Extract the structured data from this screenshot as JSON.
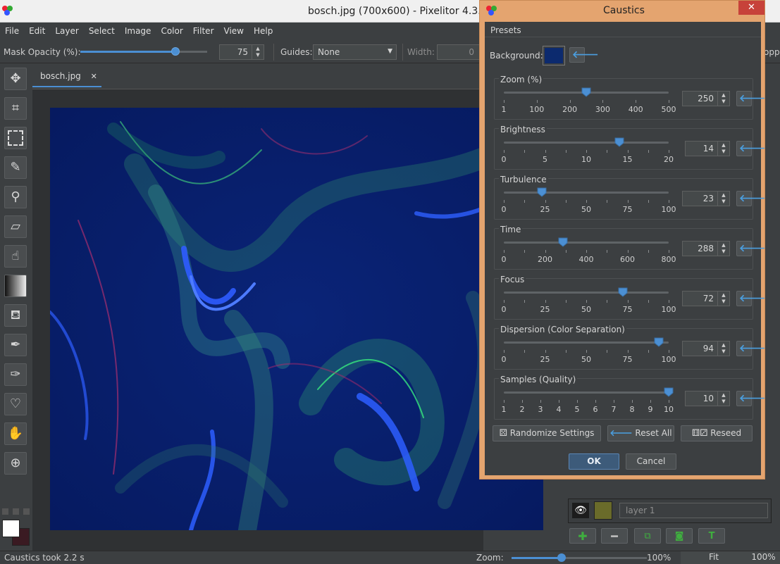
{
  "window": {
    "title": "bosch.jpg (700x600) - Pixelitor 4.3.0"
  },
  "menu": [
    "File",
    "Edit",
    "Layer",
    "Select",
    "Image",
    "Color",
    "Filter",
    "View",
    "Help"
  ],
  "toolbar": {
    "mask_opacity_label": "Mask Opacity (%):",
    "mask_opacity_value": "75",
    "mask_opacity_fraction": 0.75,
    "guides_label": "Guides:",
    "guides_value": "None",
    "width_label": "Width:",
    "width_value": "0",
    "cropped_fragment": "oppe"
  },
  "document": {
    "tab_label": "bosch.jpg",
    "tab_close": "✕"
  },
  "status": {
    "message": "Caustics took 2.2 s",
    "zoom_label": "Zoom:",
    "zoom_value": "100%",
    "fit_label": "Fit",
    "zoom_value2": "100%"
  },
  "layers": {
    "layer_name": "layer 1"
  },
  "dialog": {
    "title": "Caustics",
    "presets_label": "Presets",
    "background_label": "Background:",
    "background_color": "#0c2a6e",
    "params": [
      {
        "label": "Zoom (%)",
        "value": "250",
        "fraction": 0.499,
        "ticks": [
          "1",
          "100",
          "200",
          "300",
          "400",
          "500"
        ],
        "minor": 0
      },
      {
        "label": "Brightness",
        "value": "14",
        "fraction": 0.7,
        "ticks": [
          "0",
          "5",
          "10",
          "15",
          "20"
        ],
        "minor": 1
      },
      {
        "label": "Turbulence",
        "value": "23",
        "fraction": 0.23,
        "ticks": [
          "0",
          "25",
          "50",
          "75",
          "100"
        ],
        "minor": 1
      },
      {
        "label": "Time",
        "value": "288",
        "fraction": 0.36,
        "ticks": [
          "0",
          "200",
          "400",
          "600",
          "800"
        ],
        "minor": 1
      },
      {
        "label": "Focus",
        "value": "72",
        "fraction": 0.72,
        "ticks": [
          "0",
          "25",
          "50",
          "75",
          "100"
        ],
        "minor": 1
      },
      {
        "label": "Dispersion (Color Separation)",
        "value": "94",
        "fraction": 0.94,
        "ticks": [
          "0",
          "25",
          "50",
          "75",
          "100"
        ],
        "minor": 1
      },
      {
        "label": "Samples (Quality)",
        "value": "10",
        "fraction": 1.0,
        "ticks": [
          "1",
          "2",
          "3",
          "4",
          "5",
          "6",
          "7",
          "8",
          "9",
          "10"
        ],
        "minor": 0
      }
    ],
    "randomize_label": "Randomize Settings",
    "reset_label": "Reset All",
    "reseed_label": "Reseed",
    "ok_label": "OK",
    "cancel_label": "Cancel"
  }
}
